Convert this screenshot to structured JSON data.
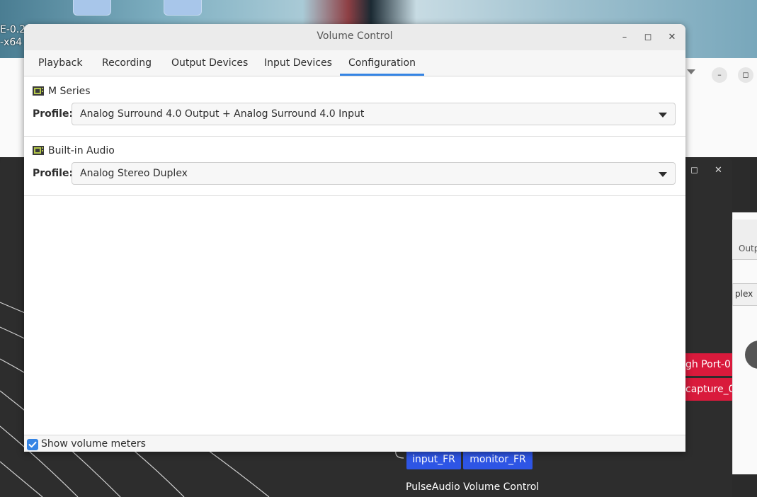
{
  "desktop": {
    "snippet_1": "E-0.2",
    "snippet_2": "-x64"
  },
  "background_patchbay": {
    "red_nodes": [
      "gh Port-0",
      "capture_0)"
    ],
    "blue_nodes": [
      "input_FR",
      "monitor_FR"
    ],
    "node_caption": "PulseAudio Volume Control",
    "right_tab_snippet": "Outp",
    "right_combo_snippet": "plex"
  },
  "window": {
    "title": "Volume Control",
    "controls": {
      "minimize": "–",
      "maximize": "◻",
      "close": "✕"
    }
  },
  "tabs": [
    {
      "label": "Playback",
      "active": false
    },
    {
      "label": "Recording",
      "active": false
    },
    {
      "label": "Output Devices",
      "active": false
    },
    {
      "label": "Input Devices",
      "active": false
    },
    {
      "label": "Configuration",
      "active": true
    }
  ],
  "cards": [
    {
      "icon": "sound-card-icon",
      "name": "M Series",
      "profile_label": "Profile:",
      "profile_value": "Analog Surround 4.0 Output + Analog Surround 4.0 Input"
    },
    {
      "icon": "sound-card-icon",
      "name": "Built-in Audio",
      "profile_label": "Profile:",
      "profile_value": "Analog Stereo Duplex"
    }
  ],
  "footer": {
    "show_volume_meters_label": "Show volume meters",
    "show_volume_meters_checked": true
  },
  "colors": {
    "accent": "#3584e4",
    "node_red": "#d91a3c",
    "node_blue": "#2e55e5"
  }
}
